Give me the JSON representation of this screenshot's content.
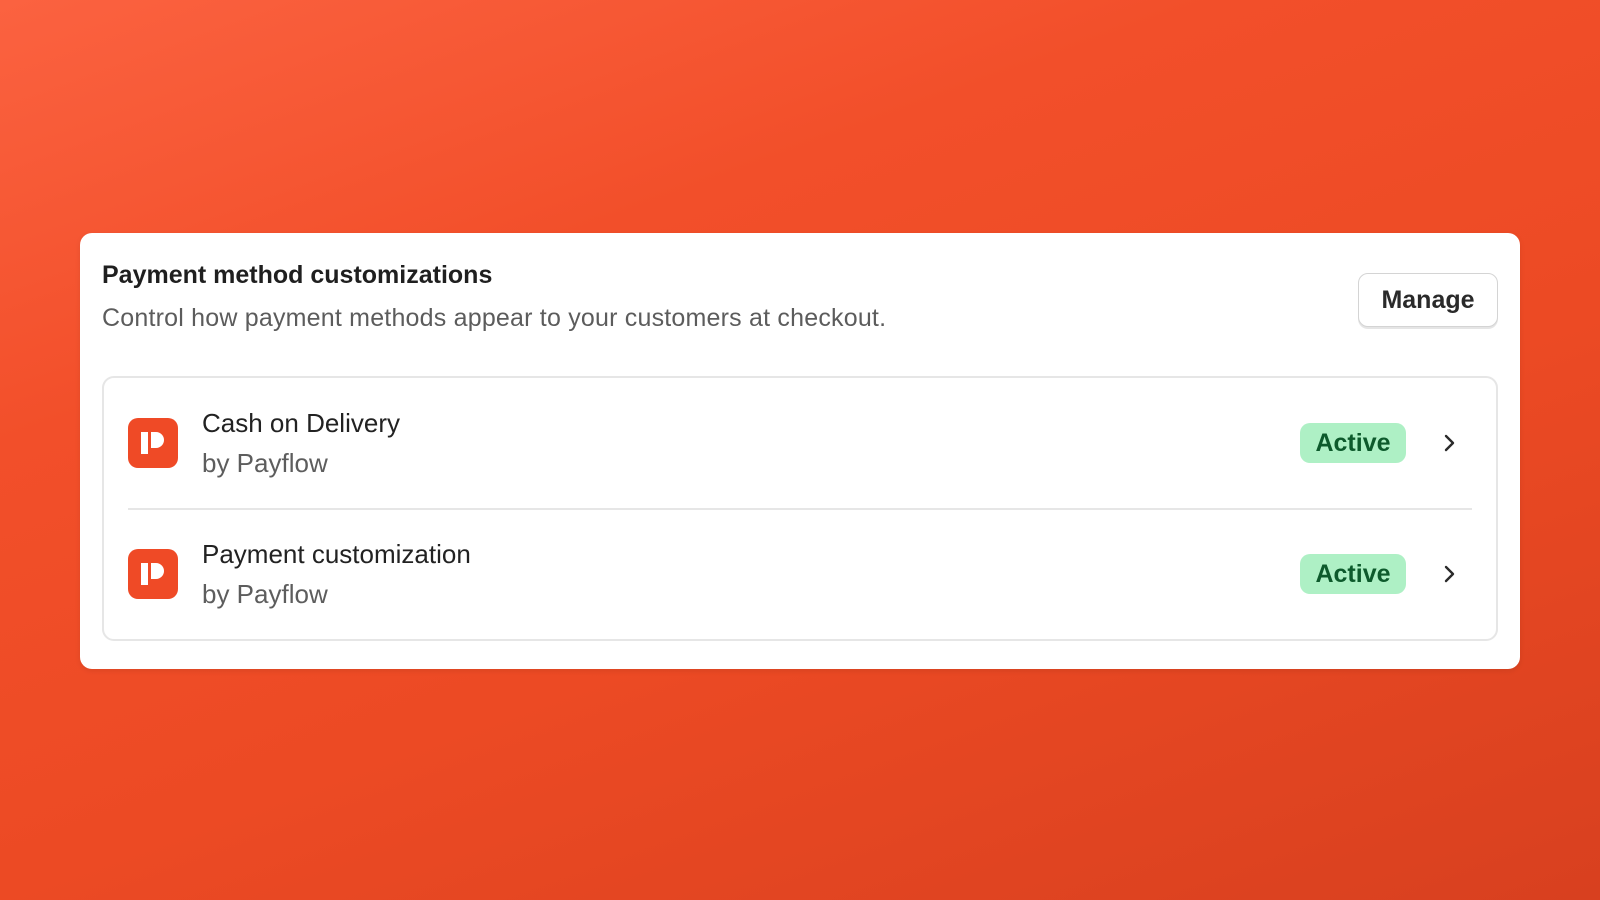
{
  "card": {
    "title": "Payment method customizations",
    "subtitle": "Control how payment methods appear to your customers at checkout.",
    "manage_label": "Manage"
  },
  "items": [
    {
      "name": "Cash on Delivery",
      "vendor": "by Payflow",
      "status": "Active",
      "icon": "payflow-logo-icon"
    },
    {
      "name": "Payment customization",
      "vendor": "by Payflow",
      "status": "Active",
      "icon": "payflow-logo-icon"
    }
  ],
  "colors": {
    "background_accent": "#f24f2a",
    "app_icon": "#ef4a26",
    "badge_bg": "#aef0c5",
    "badge_text": "#0d5a2c"
  }
}
